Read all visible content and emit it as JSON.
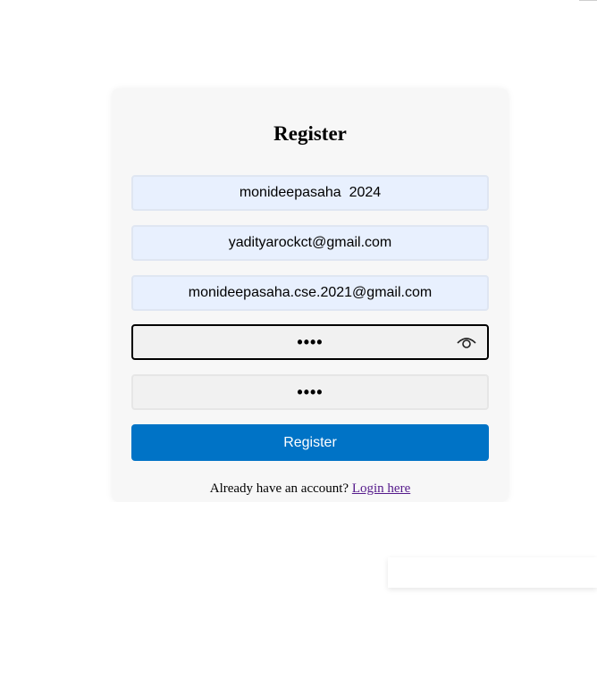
{
  "form": {
    "title": "Register",
    "username_value": "monideepasaha  2024",
    "email_value": "yadityarockct@gmail.com",
    "email2_value": "monideepasaha.cse.2021@gmail.com",
    "password_value": "••••",
    "confirm_password_value": "••••",
    "submit_label": "Register"
  },
  "footer": {
    "prompt": "Already have an account? ",
    "link_label": "Login here"
  },
  "colors": {
    "accent": "#0073c6",
    "autofill_bg": "#e8f0fe",
    "card_bg": "#f7f7f7",
    "link": "#551a8b"
  },
  "icons": {
    "password_toggle": "eye-icon"
  }
}
